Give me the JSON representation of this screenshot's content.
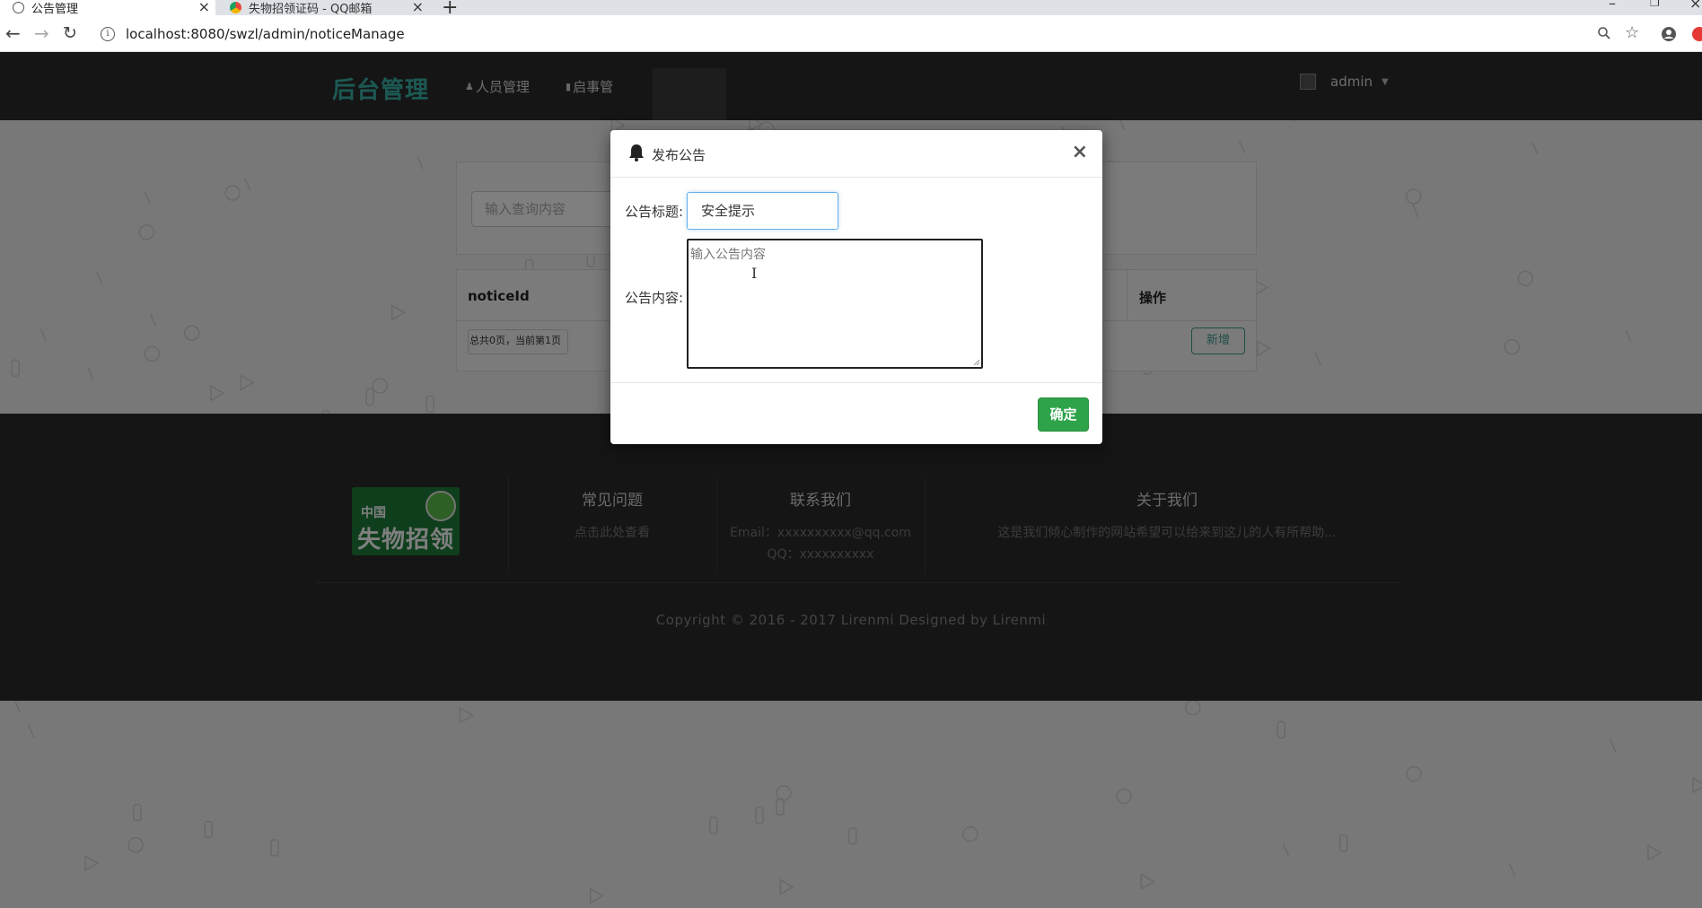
{
  "browser": {
    "tabs": [
      {
        "title": "公告管理",
        "active": true
      },
      {
        "title": "失物招领证码 - QQ邮箱",
        "active": false
      }
    ],
    "new_tab_glyph": "+",
    "url": "localhost:8080/swzl/admin/noticeManage"
  },
  "navbar": {
    "brand": "后台管理",
    "items": [
      {
        "label": "人员管理",
        "icon": "user-icon"
      },
      {
        "label": "启事管",
        "icon": "file-icon"
      }
    ],
    "user": "admin"
  },
  "search": {
    "placeholder": "输入查询内容"
  },
  "table": {
    "columns": [
      "noticeId",
      "操作"
    ],
    "pagination": "总共0页，当前第1页",
    "add_button": "新增"
  },
  "footer": {
    "logo": {
      "line1": "中国",
      "line2": "失物招领"
    },
    "faq": {
      "title": "常见问题",
      "link": "点击此处查看"
    },
    "contact": {
      "title": "联系我们",
      "email": "Email：xxxxxxxxxx@qq.com",
      "qq": "QQ：xxxxxxxxxx"
    },
    "about": {
      "title": "关于我们",
      "text": "这是我们倾心制作的网站希望可以给来到这儿的人有所帮助..."
    },
    "copyright": "Copyright © 2016 - 2017 Lirenmi Designed by Lirenmi"
  },
  "modal": {
    "title": "发布公告",
    "close_glyph": "×",
    "title_label": "公告标题:",
    "title_value": "安全提示",
    "content_label": "公告内容:",
    "content_placeholder": "输入公告内容",
    "confirm": "确定"
  },
  "colors": {
    "brand": "#3bb3a8",
    "navbar": "#2b2b2b",
    "footer": "#2a2a2a",
    "confirm": "#2ea34a",
    "add_button": "#3a9c8f"
  }
}
